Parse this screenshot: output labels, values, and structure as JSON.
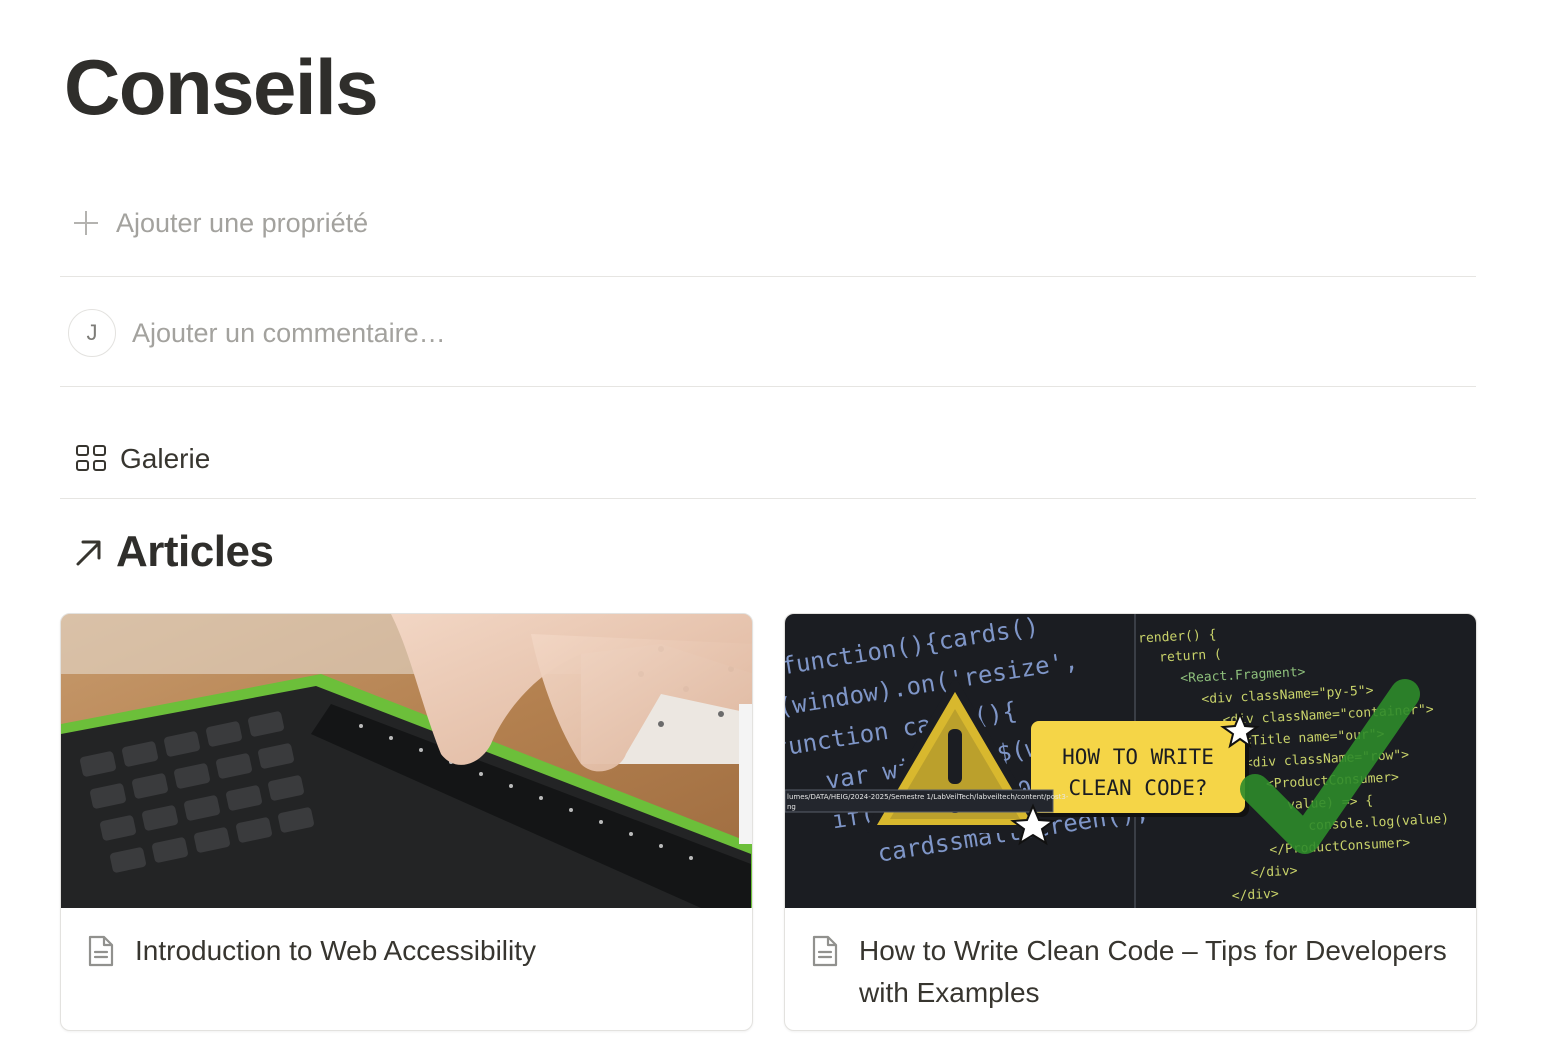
{
  "page": {
    "title": "Conseils"
  },
  "properties": {
    "add_label": "Ajouter une propriété"
  },
  "comments": {
    "avatar_initial": "J",
    "placeholder": "Ajouter un commentaire…"
  },
  "view": {
    "icon": "grid-icon",
    "label": "Galerie"
  },
  "section": {
    "icon": "arrow-up-right-icon",
    "title": "Articles"
  },
  "cards": [
    {
      "title": "Introduction to Web Accessibility",
      "icon": "document-icon",
      "cover": "braille-keyboard-photo"
    },
    {
      "title": "How to Write Clean Code – Tips for Developers with Examples",
      "icon": "document-icon",
      "cover": "clean-code-banner",
      "cover_banner_text": "HOW TO WRITE\nCLEAN CODE?",
      "cover_tooltip": "lumes/DATA/HEIG/2024-2025/Semestre 1/LabVeilTech/labveiltech/content/post3-\nng"
    }
  ],
  "colors": {
    "text": "#37352f",
    "muted": "#a3a29e",
    "divider": "#e6e5e2",
    "banner_yellow": "#f5d547"
  }
}
